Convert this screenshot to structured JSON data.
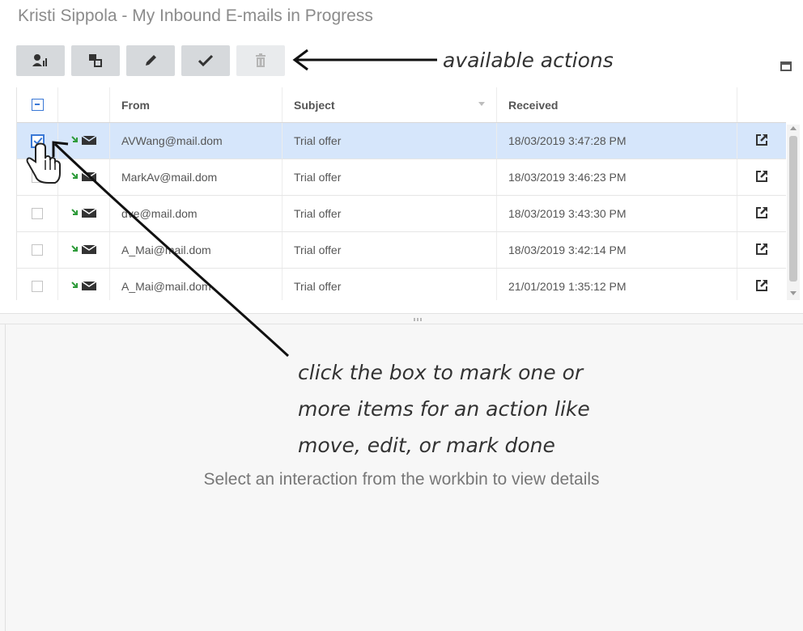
{
  "window": {
    "title": "Kristi Sippola - My Inbound E-mails in Progress"
  },
  "toolbar": {
    "buttons": [
      {
        "icon": "assign-icon",
        "enabled": true
      },
      {
        "icon": "move-icon",
        "enabled": true
      },
      {
        "icon": "edit-pencil-icon",
        "enabled": true
      },
      {
        "icon": "mark-done-check-icon",
        "enabled": true
      },
      {
        "icon": "delete-trash-icon",
        "enabled": false
      }
    ]
  },
  "grid": {
    "columns": {
      "from": "From",
      "subject": "Subject",
      "received": "Received"
    },
    "rows": [
      {
        "from": "AVWang@mail.dom",
        "subject": "Trial offer",
        "received": "18/03/2019 3:47:28 PM",
        "checked": true
      },
      {
        "from": "MarkAv@mail.dom",
        "subject": "Trial offer",
        "received": "18/03/2019 3:46:23 PM",
        "checked": false
      },
      {
        "from": "dve@mail.dom",
        "subject": "Trial offer",
        "received": "18/03/2019 3:43:30 PM",
        "checked": false
      },
      {
        "from": "A_Mai@mail.dom",
        "subject": "Trial offer",
        "received": "18/03/2019 3:42:14 PM",
        "checked": false
      },
      {
        "from": "A_Mai@mail.dom",
        "subject": "Trial offer",
        "received": "21/01/2019 1:35:12 PM",
        "checked": false
      }
    ]
  },
  "detail": {
    "placeholder": "Select an interaction from the workbin to view details"
  },
  "annotations": {
    "available_actions": "available actions",
    "click_box": [
      "click the box to mark one or",
      "more items for an action like",
      "move, edit, or mark done"
    ]
  },
  "colors": {
    "selected_row": "#d6e6fb",
    "checkbox_accent": "#3a78d6",
    "inbound_arrow": "#2e9b3a"
  }
}
